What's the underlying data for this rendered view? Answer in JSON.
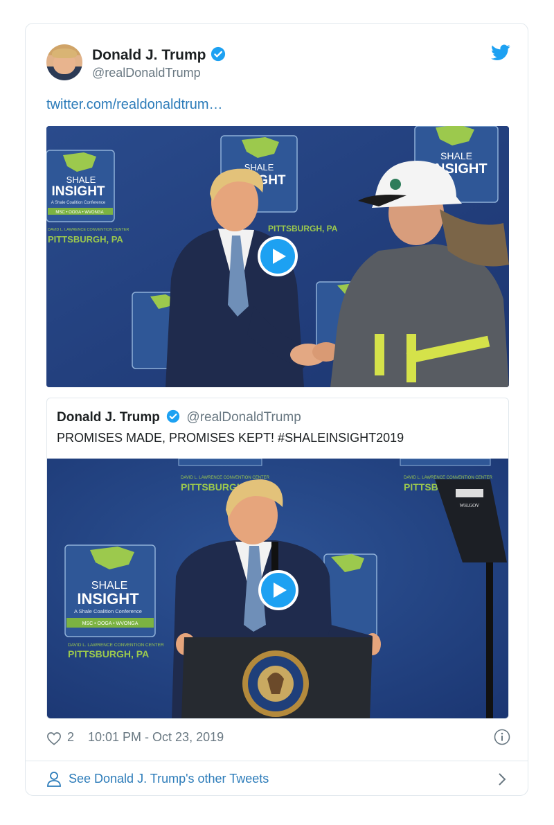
{
  "tweet": {
    "author_name": "Donald J. Trump",
    "author_handle": "@realDonaldTrump",
    "link_text": "twitter.com/realdonaldtrum…",
    "likes": "2",
    "timestamp": "10:01 PM - Oct 23, 2019"
  },
  "media1": {
    "logo_left": {
      "line1": "SHALE",
      "line2": "INSIGHT",
      "tag": "A Shale Coalition Conference",
      "bar": "MSC • OOGA • WVONGA",
      "venue": "DAVID L. LAWRENCE CONVENTION CENTER",
      "city": "PITTSBURGH, PA"
    },
    "logo_center": {
      "line1": "SHALE",
      "line2": "INSIGHT",
      "city": "PITTSBURGH, PA"
    },
    "logo_right": {
      "line1": "SHALE",
      "line2": "INSIGHT"
    }
  },
  "quoted_tweet": {
    "author_name": "Donald J. Trump",
    "author_handle": "@realDonaldTrump",
    "text": "PROMISES MADE, PROMISES KEPT! #SHALEINSIGHT2019"
  },
  "media2": {
    "venue_top": "DAVID L. LAWRENCE CONVENTION CENTER",
    "city_top": "PITTSBURGH, PA",
    "logo": {
      "line1": "SHALE",
      "line2": "INSIGHT",
      "tag": "A Shale Coalition Conference",
      "bar": "MSC • OOGA • WVONGA",
      "venue": "DAVID L. LAWRENCE CONVENTION CENTER",
      "city": "PITTSBURGH, PA"
    },
    "watermark": "WH.GOV"
  },
  "more_tweets_label": "See Donald J. Trump's other Tweets",
  "colors": {
    "twitter_blue": "#1da1f2",
    "link_blue": "#2b7bb9",
    "stage_blue": "#24407e",
    "logo_green": "#8bc34a"
  },
  "icons": [
    "verified-badge-icon",
    "twitter-bird-icon",
    "play-icon",
    "heart-icon",
    "info-icon",
    "person-icon",
    "chevron-right-icon"
  ]
}
